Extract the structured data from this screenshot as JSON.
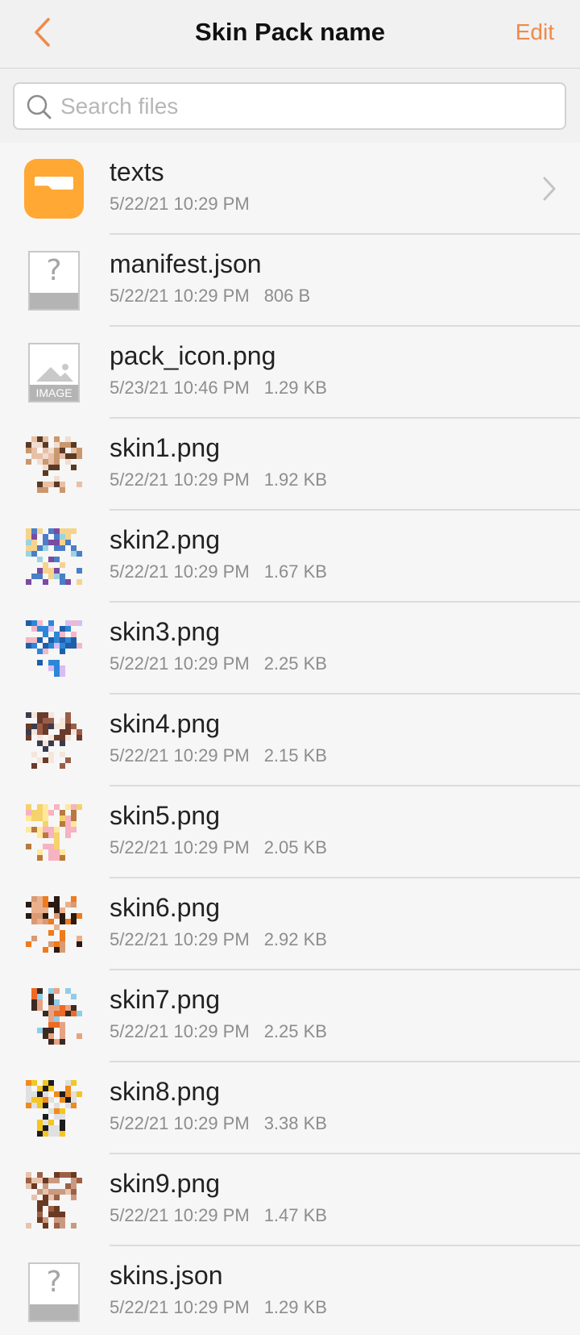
{
  "header": {
    "title": "Skin Pack name",
    "edit_label": "Edit"
  },
  "search": {
    "placeholder": "Search files"
  },
  "files": [
    {
      "name": "texts",
      "date": "5/22/21 10:29 PM",
      "size": "",
      "icon": "folder-icon",
      "has_chevron": true
    },
    {
      "name": "manifest.json",
      "date": "5/22/21 10:29 PM",
      "size": "806 B",
      "icon": "unknown-file-icon"
    },
    {
      "name": "pack_icon.png",
      "date": "5/23/21 10:46 PM",
      "size": "1.29 KB",
      "icon": "image-file-icon",
      "icon_label": "IMAGE"
    },
    {
      "name": "skin1.png",
      "date": "5/22/21 10:29 PM",
      "size": "1.92 KB",
      "icon": "skin-thumbnail",
      "palette": [
        "#e8c0a6",
        "#5b3a24",
        "#c9986e",
        "#f0ddd0"
      ]
    },
    {
      "name": "skin2.png",
      "date": "5/22/21 10:29 PM",
      "size": "1.67 KB",
      "icon": "skin-thumbnail",
      "palette": [
        "#f6d38d",
        "#4a7ec6",
        "#9bd3e0",
        "#7b4aa2"
      ]
    },
    {
      "name": "skin3.png",
      "date": "5/22/21 10:29 PM",
      "size": "2.25 KB",
      "icon": "skin-thumbnail",
      "palette": [
        "#d7bdf1",
        "#2f86d8",
        "#f3b8c6",
        "#1f5fa8"
      ]
    },
    {
      "name": "skin4.png",
      "date": "5/22/21 10:29 PM",
      "size": "2.15 KB",
      "icon": "skin-thumbnail",
      "palette": [
        "#6a3a2a",
        "#f4e6dc",
        "#3b3b4d",
        "#9a5e48"
      ]
    },
    {
      "name": "skin5.png",
      "date": "5/22/21 10:29 PM",
      "size": "2.05 KB",
      "icon": "skin-thumbnail",
      "palette": [
        "#f7b2c4",
        "#ffe89a",
        "#f5d26b",
        "#b87a3c"
      ]
    },
    {
      "name": "skin6.png",
      "date": "5/22/21 10:29 PM",
      "size": "2.92 KB",
      "icon": "skin-thumbnail",
      "palette": [
        "#d99a74",
        "#f07a1c",
        "#2a1a12",
        "#eab08c"
      ]
    },
    {
      "name": "skin7.png",
      "date": "5/22/21 10:29 PM",
      "size": "2.25 KB",
      "icon": "skin-thumbnail",
      "palette": [
        "#e6a383",
        "#ef6a22",
        "#8fcde8",
        "#3b2a22"
      ]
    },
    {
      "name": "skin8.png",
      "date": "5/22/21 10:29 PM",
      "size": "3.38 KB",
      "icon": "skin-thumbnail",
      "palette": [
        "#f3c623",
        "#1c1c1c",
        "#e0e0e0",
        "#f08a1c"
      ]
    },
    {
      "name": "skin9.png",
      "date": "5/22/21 10:29 PM",
      "size": "1.47 KB",
      "icon": "skin-thumbnail",
      "palette": [
        "#c99a80",
        "#6b3a22",
        "#e7c3ad",
        "#9c6044"
      ]
    },
    {
      "name": "skins.json",
      "date": "5/22/21 10:29 PM",
      "size": "1.29 KB",
      "icon": "unknown-file-icon"
    }
  ],
  "colors": {
    "accent": "#ee8a4b",
    "folder": "#ffa834",
    "background": "#f6f6f6"
  }
}
